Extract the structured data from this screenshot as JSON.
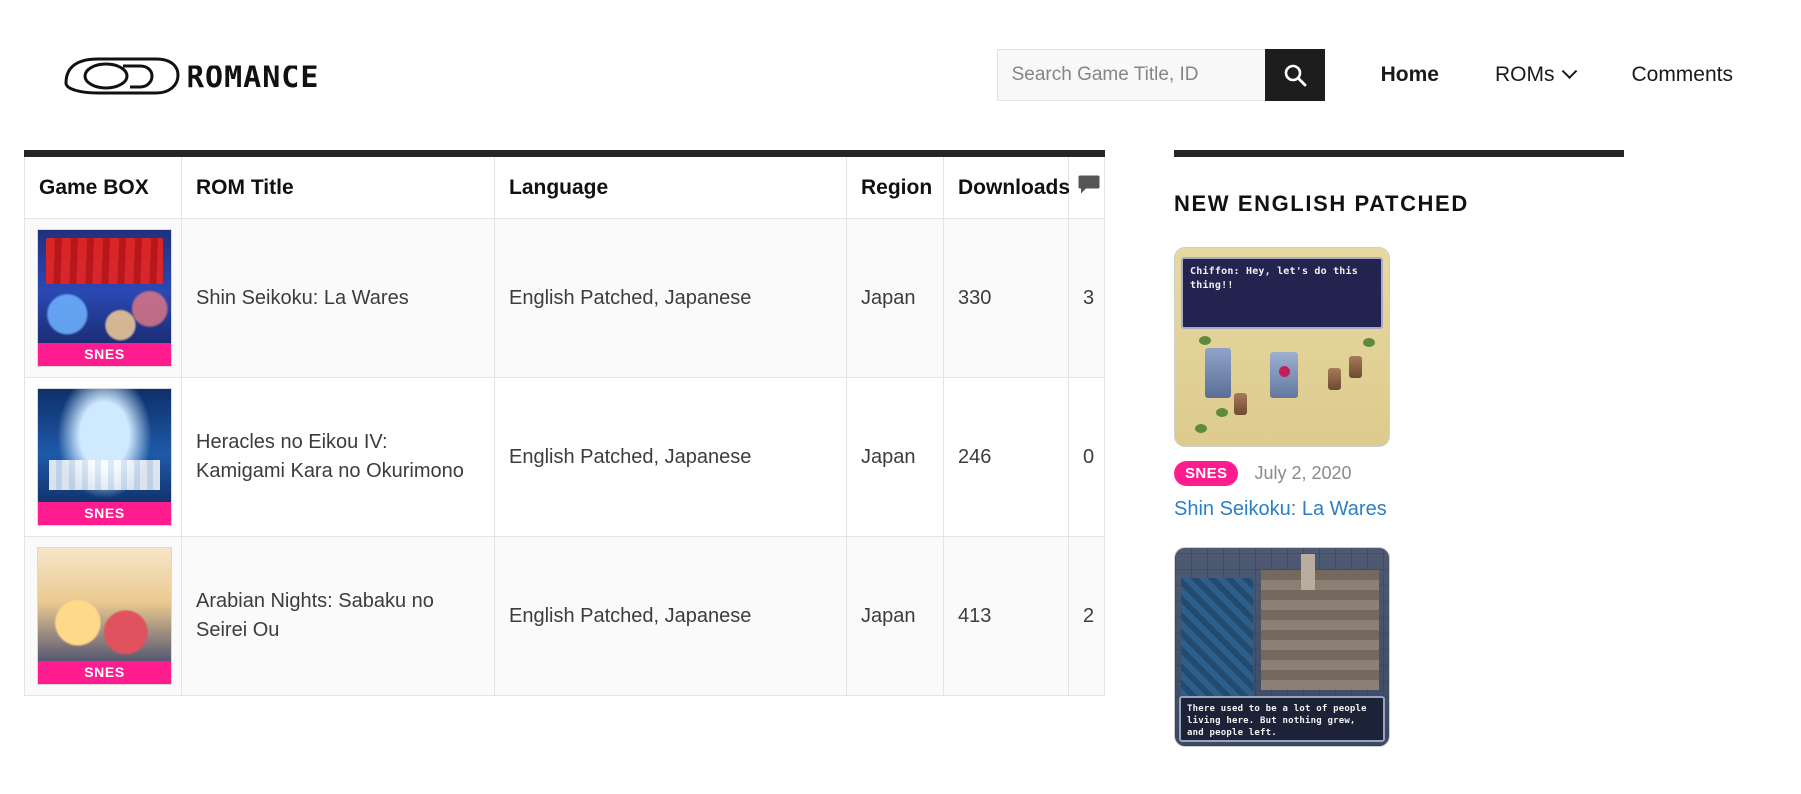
{
  "header": {
    "logo_text": "CDROMANCE",
    "logo_icon": "cd-disc-icon",
    "search": {
      "placeholder": "Search Game Title, ID",
      "value": "",
      "button_icon": "search-icon"
    },
    "nav": [
      {
        "label": "Home",
        "active": true,
        "has_dropdown": false
      },
      {
        "label": "ROMs",
        "active": false,
        "has_dropdown": true,
        "dropdown_icon": "chevron-down-icon"
      },
      {
        "label": "Comments",
        "active": false,
        "has_dropdown": false
      }
    ]
  },
  "table": {
    "columns": [
      "Game BOX",
      "ROM Title",
      "Language",
      "Region",
      "Downloads",
      "comment-icon"
    ],
    "comment_header_icon": "comment-bubble-icon",
    "rows": [
      {
        "platform": "SNES",
        "box_art_class": "art-laWares",
        "title": "Shin Seikoku: La Wares",
        "language": "English Patched, Japanese",
        "region": "Japan",
        "downloads": "330",
        "comments": "3"
      },
      {
        "platform": "SNES",
        "box_art_class": "art-heracles",
        "title": "Heracles no Eikou IV: Kamigami Kara no Okurimono",
        "language": "English Patched, Japanese",
        "region": "Japan",
        "downloads": "246",
        "comments": "0"
      },
      {
        "platform": "SNES",
        "box_art_class": "art-arabian",
        "title": "Arabian Nights: Sabaku no Seirei Ou",
        "language": "English Patched, Japanese",
        "region": "Japan",
        "downloads": "413",
        "comments": "2"
      }
    ]
  },
  "sidebar": {
    "heading": "NEW ENGLISH PATCHED",
    "cards": [
      {
        "thumb_caption": "Chiffon: Hey, let's do this thing!!",
        "platform": "SNES",
        "date": "July 2, 2020",
        "title": "Shin Seikoku: La Wares"
      },
      {
        "thumb_caption": "There used to be a lot of people living here. But nothing grew, and people left.",
        "platform": "",
        "date": "",
        "title": ""
      }
    ]
  },
  "colors": {
    "accent_pink": "#ff1c8e",
    "link_blue": "#2b7fc4",
    "rule_dark": "#262626"
  }
}
